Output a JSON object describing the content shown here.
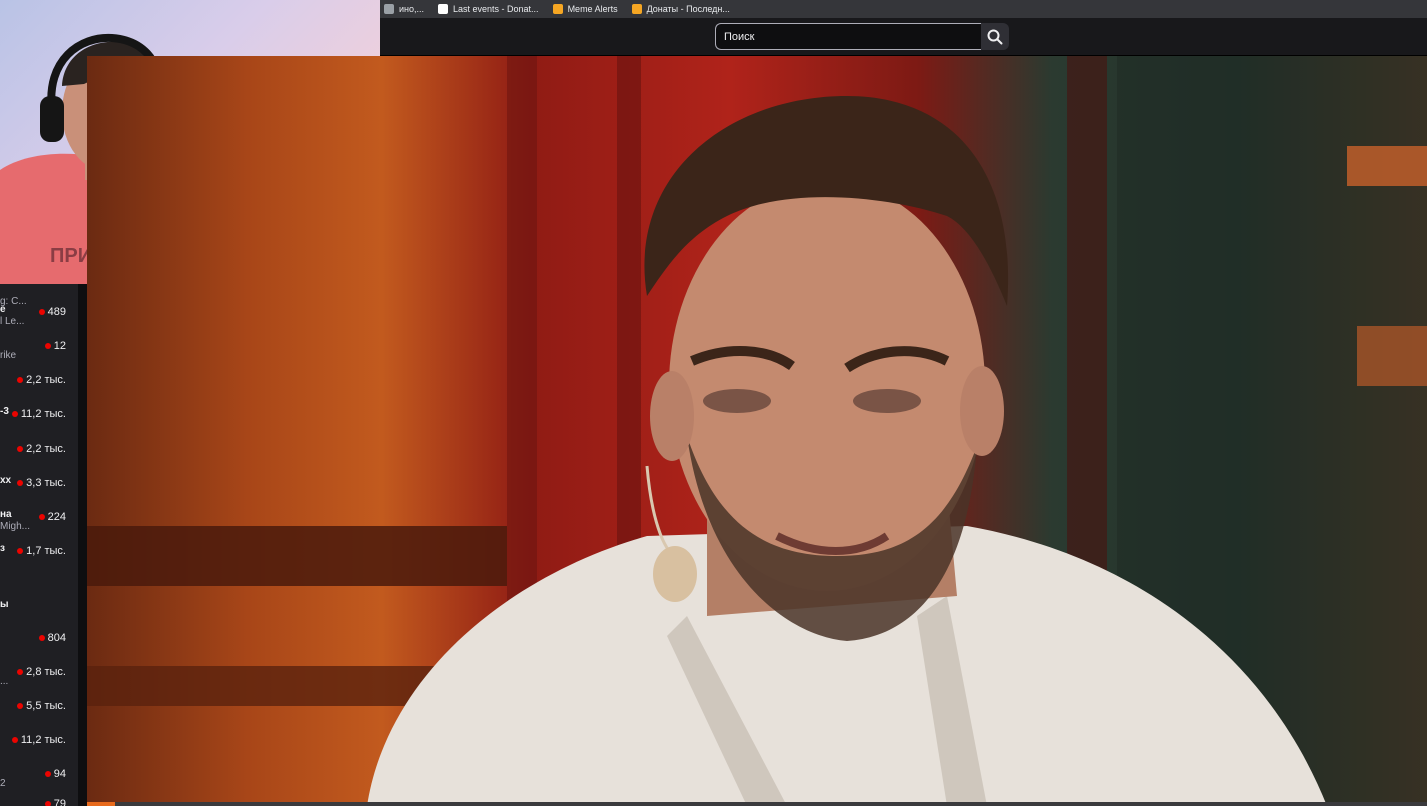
{
  "bookmarks": [
    {
      "label": "ино,...",
      "icon": "bookmark-icon",
      "color": "#9aa0a6"
    },
    {
      "label": "Last events - Donat...",
      "icon": "donationalerts-icon",
      "color": "#ffffff"
    },
    {
      "label": "Meme Alerts",
      "icon": "memealerts-icon",
      "color": "#f5a623"
    },
    {
      "label": "Донаты - Последн...",
      "icon": "donatepay-icon",
      "color": "#f5a623"
    }
  ],
  "search": {
    "placeholder": "Поиск",
    "icon": "search-icon"
  },
  "sidebar": {
    "channels": [
      {
        "name": "",
        "sub": "g: C...",
        "viewers": ""
      },
      {
        "name": "e",
        "sub": "l Le...",
        "viewers": "489"
      },
      {
        "name": "",
        "sub": "rike",
        "viewers": "12"
      },
      {
        "name": "",
        "sub": "",
        "viewers": "2,2 тыс."
      },
      {
        "name": "-3",
        "sub": "",
        "viewers": "11,2 тыс."
      },
      {
        "name": "",
        "sub": "",
        "viewers": "2,2 тыс."
      },
      {
        "name": "xx",
        "sub": "",
        "viewers": "3,3 тыс."
      },
      {
        "name": "на",
        "sub": "Migh...",
        "viewers": "224"
      },
      {
        "name": "з",
        "sub": "",
        "viewers": "1,7 тыс."
      },
      {
        "name": "ы",
        "sub": "",
        "viewers": ""
      },
      {
        "name": "",
        "sub": "",
        "viewers": "804"
      },
      {
        "name": "",
        "sub": "...",
        "viewers": "2,8 тыс."
      },
      {
        "name": "",
        "sub": "",
        "viewers": "5,5 тыс."
      },
      {
        "name": "",
        "sub": "",
        "viewers": "11,2 тыс."
      },
      {
        "name": "",
        "sub": "2",
        "viewers": "94"
      },
      {
        "name": "",
        "sub": "",
        "viewers": "79"
      }
    ]
  },
  "video": {
    "progress_fraction": 0.021
  },
  "colors": {
    "accent": "#e86a1c",
    "live": "#eb0400"
  }
}
